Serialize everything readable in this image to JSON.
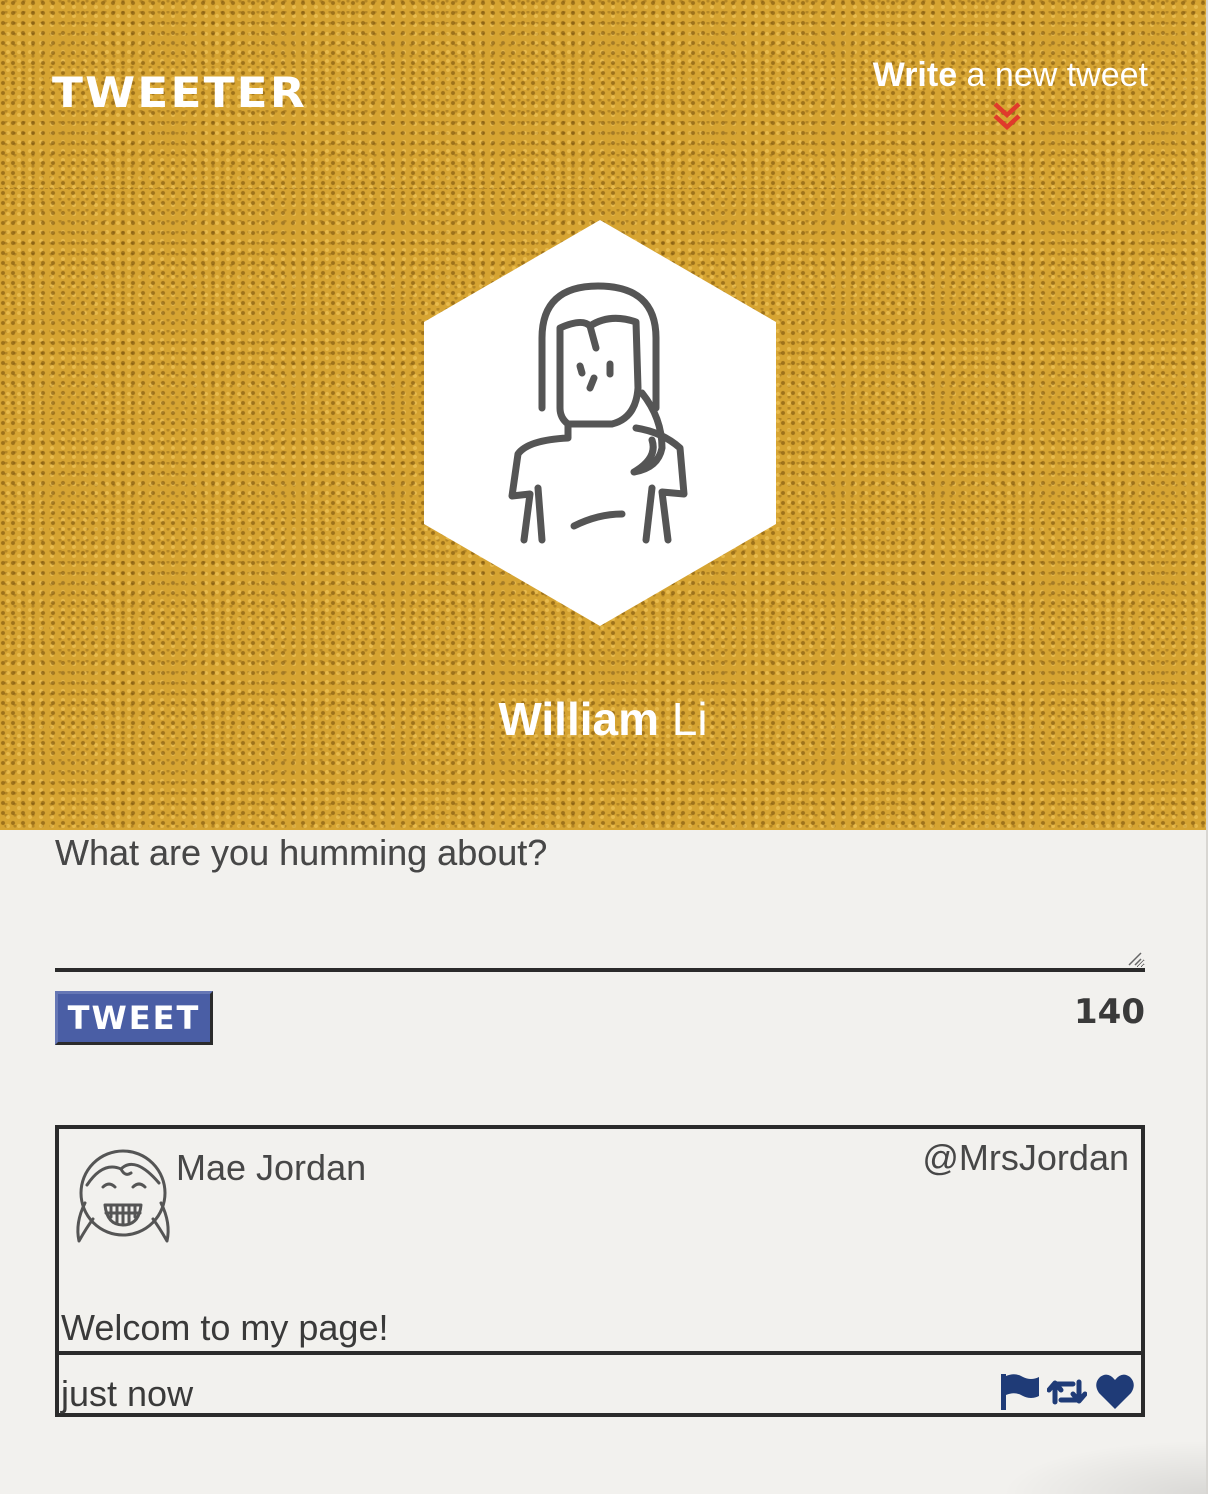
{
  "app": {
    "brand": "TWEETER"
  },
  "nav": {
    "compose_bold": "Write",
    "compose_rest": " a new tweet",
    "compose_icon": "double-chevron-down-icon"
  },
  "profile": {
    "first_name": "William",
    "last_name": "Li",
    "avatar_icon": "person-long-hair-icon"
  },
  "composer": {
    "placeholder": "What are you humming about?",
    "value": "",
    "submit_label": "TWEET",
    "char_count": "140"
  },
  "tweets": [
    {
      "author": "Mae Jordan",
      "handle": "@MrsJordan",
      "avatar_icon": "smiling-girl-icon",
      "text": "Welcom to my page!",
      "time": "just now",
      "actions": [
        "flag-icon",
        "retweet-icon",
        "heart-icon"
      ]
    }
  ],
  "colors": {
    "hero": "#d6a432",
    "accent": "#4a5ea5",
    "action_icons": "#1f3b77",
    "chevron": "#e03a2b",
    "page": "#f2f1ee"
  }
}
